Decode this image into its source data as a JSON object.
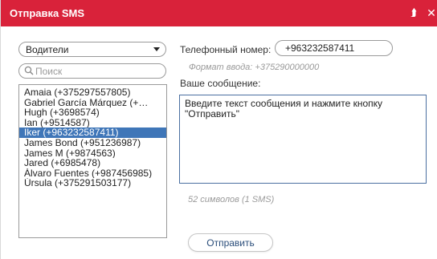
{
  "window": {
    "title": "Отправка SMS",
    "collapse_icon": "chevrons-up-icon",
    "close_icon": "close-icon",
    "accent_color": "#d9223a"
  },
  "group_select": {
    "selected": "Водители"
  },
  "search": {
    "placeholder": "Поиск",
    "value": ""
  },
  "contacts": [
    "Amaia (+375297557805)",
    "Gabriel García Márquez (+…",
    "Hugh (+3698574)",
    "Ian (+9514587)",
    "Iker (+963232587411)",
    "James Bond (+951236987)",
    "James M (+9874563)",
    "Jared (+6985478)",
    "Álvaro Fuentes (+987456985)",
    "Úrsula (+375291503177)"
  ],
  "selected_contact_index": 4,
  "selection_color": "#3f76b8",
  "phone": {
    "label": "Телефонный номер:",
    "value": "+963232587411",
    "format_hint": "Формат ввода: +375290000000"
  },
  "message": {
    "label": "Ваше сообщение:",
    "value": "Введите текст сообщения и нажмите кнопку\n\"Отправить\"",
    "char_count": "52 символов (1 SMS)"
  },
  "send_button": {
    "label": "Отправить"
  }
}
